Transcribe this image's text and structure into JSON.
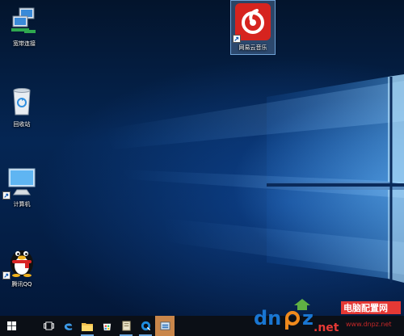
{
  "desktop": {
    "icons": [
      {
        "label": "宽带连接",
        "icon": "network-computers-icon"
      },
      {
        "label": "网易云音乐",
        "icon": "netease-music-icon"
      },
      {
        "label": "回收站",
        "icon": "recycle-bin-icon"
      },
      {
        "label": "计算机",
        "icon": "computer-monitor-icon"
      },
      {
        "label": "腾讯QQ",
        "icon": "qq-penguin-icon"
      }
    ]
  },
  "taskbar": {
    "items": [
      "start-icon",
      "task-view-icon",
      "edge-icon",
      "file-explorer-icon",
      "store-icon",
      "document-icon",
      "qq-browser-icon",
      "app-icon"
    ]
  },
  "watermark": {
    "brand": "dnpz.net",
    "brand_left": "dn",
    "brand_right": "z",
    "tld": ".net",
    "title": "电脑配置网",
    "url": "www.dnpz.net"
  },
  "colors": {
    "netease_red": "#d6241f",
    "taskbar": "#0b0f16",
    "active_task": "#c9864a",
    "watermark_blue": "#1976d2",
    "watermark_orange": "#f08a1d",
    "watermark_red": "#e53935"
  }
}
